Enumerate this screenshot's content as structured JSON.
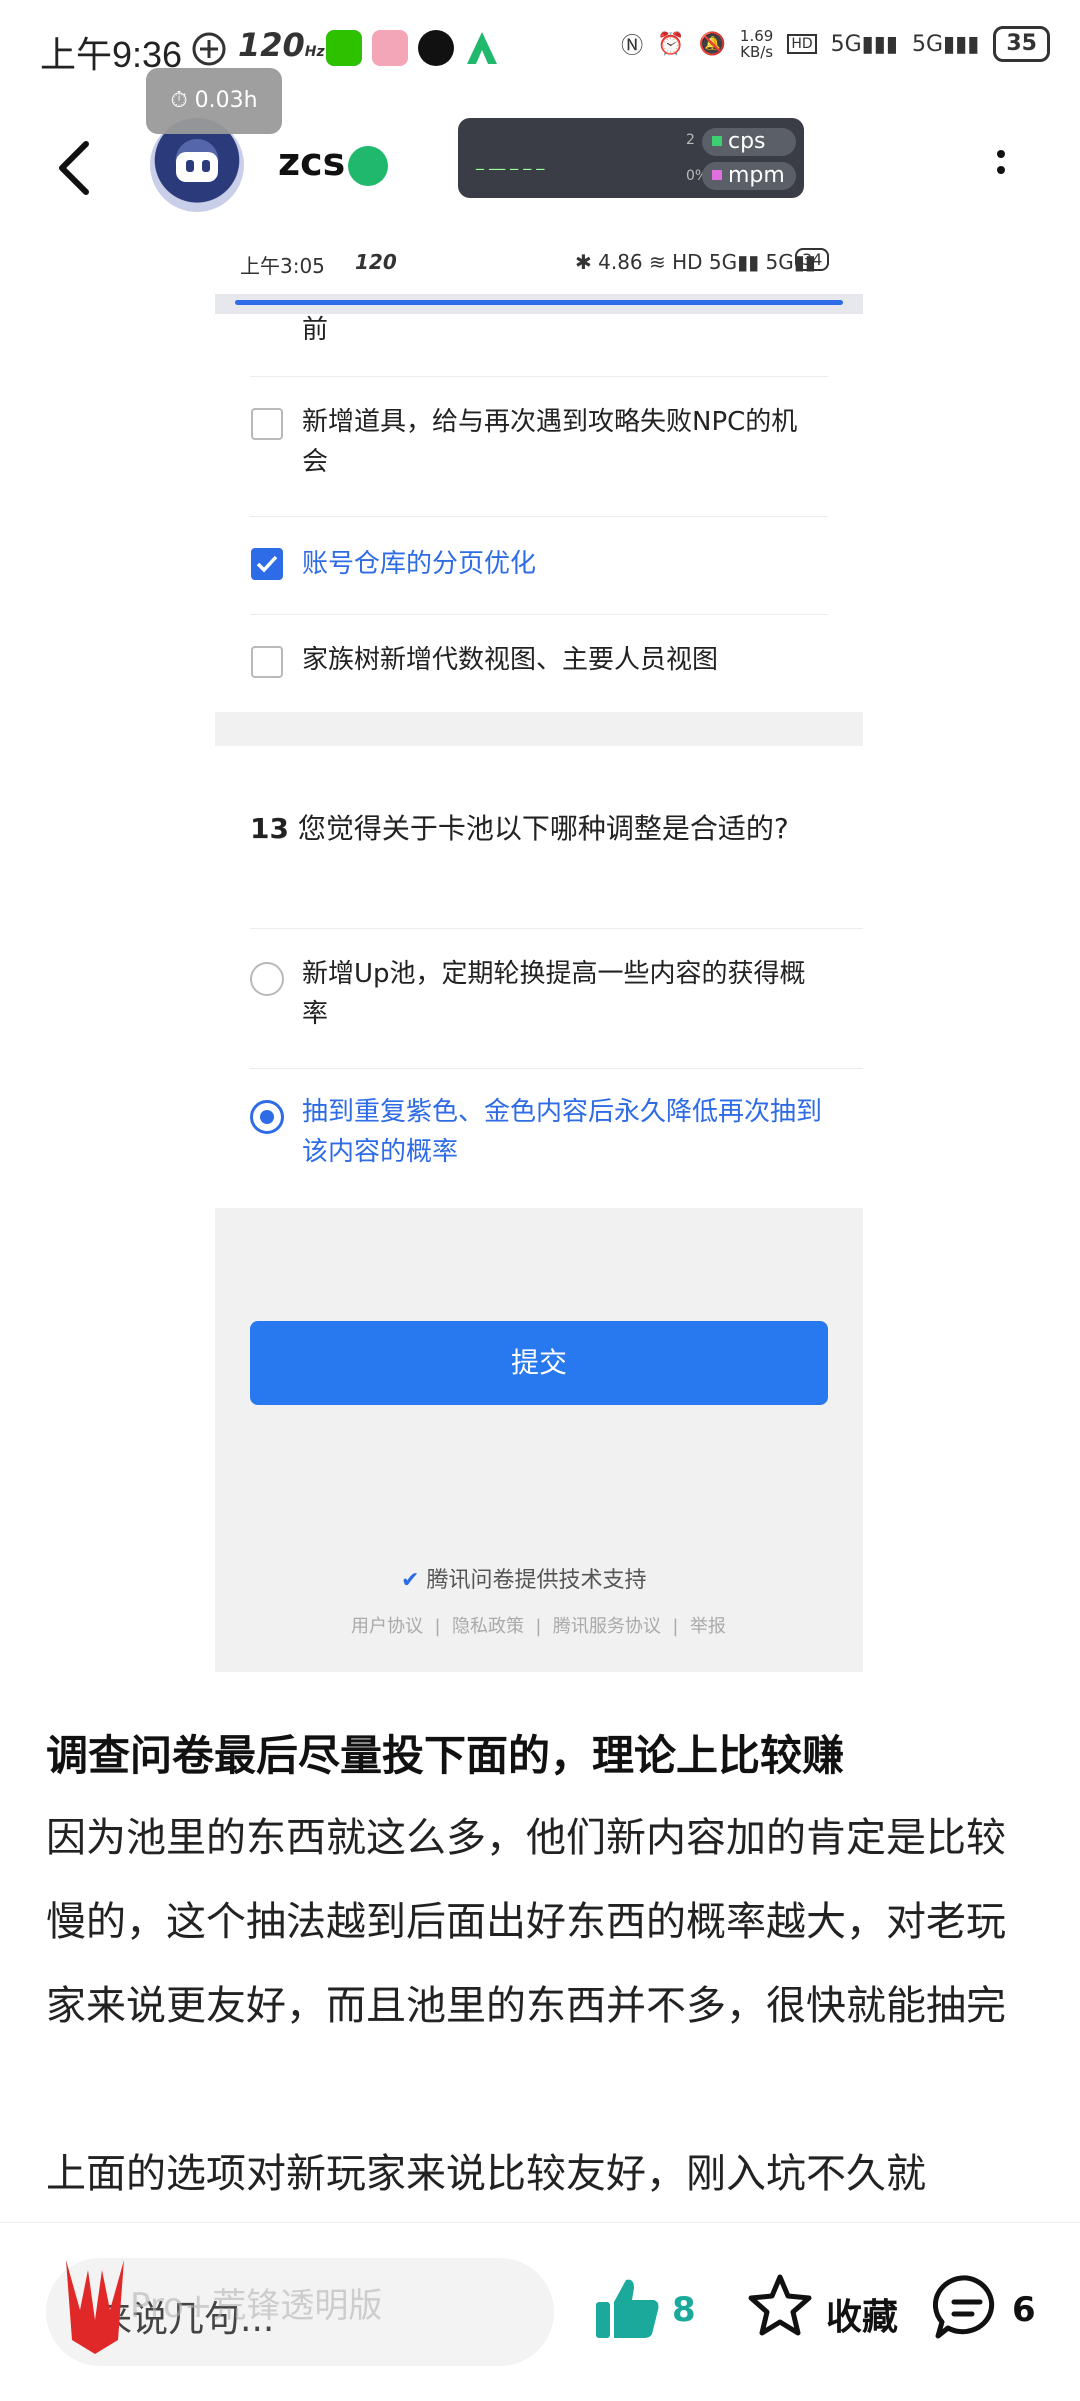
{
  "status_bar": {
    "time": "上午9:36",
    "refresh": "120",
    "speed": "1.69",
    "speed_unit": "KB/s",
    "battery": "35"
  },
  "header": {
    "timer": "0.03h",
    "username": "zcs",
    "cps_label": "cps",
    "mpm_label": "mpm",
    "cps_value": "2",
    "mpm_value": "0%"
  },
  "embedded": {
    "status_time": "上午3:05",
    "status_refresh": "120",
    "status_speed": "4.86",
    "status_battery": "34",
    "q12_partial_line": "前",
    "q12_options": [
      {
        "label": "新增道具，给与再次遇到攻略失败NPC的机会",
        "checked": false
      },
      {
        "label": "账号仓库的分页优化",
        "checked": true
      },
      {
        "label": "家族树新增代数视图、主要人员视图",
        "checked": false
      }
    ],
    "q13_number": "13",
    "q13_text": "您觉得关于卡池以下哪种调整是合适的?",
    "q13_options": [
      {
        "label": "新增Up池，定期轮换提高一些内容的获得概率",
        "selected": false
      },
      {
        "label": "抽到重复紫色、金色内容后永久降低再次抽到该内容的概率",
        "selected": true
      }
    ],
    "submit_label": "提交",
    "support_text": "腾讯问卷提供技术支持",
    "footer_links": [
      "用户协议",
      "隐私政策",
      "腾讯服务协议",
      "举报"
    ]
  },
  "article": {
    "heading": "调查问卷最后尽量投下面的，理论上比较赚",
    "para1": "因为池里的东西就这么多，他们新内容加的肯定是比较慢的，这个抽法越到后面出好东西的概率越大，对老玩家来说更友好，而且池里的东西并不多，很快就能抽完",
    "para2": "上面的选项对新玩家来说比较友好，刚入坑不久就"
  },
  "bottom_bar": {
    "input_placeholder": "来说几句...",
    "watermark": "Pro+荒锋透明版",
    "like_count": "8",
    "favorite_label": "收藏",
    "comment_count": "6"
  },
  "colors": {
    "accent": "#2e6be6",
    "submit": "#2878f0",
    "like": "#1aa99a"
  }
}
